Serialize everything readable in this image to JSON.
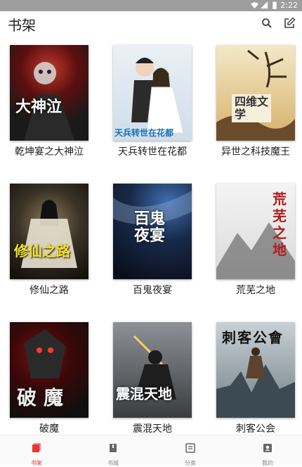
{
  "status_bar": {
    "time": "2:22"
  },
  "header": {
    "title": "书架"
  },
  "books": [
    {
      "title": "乾坤宴之大神泣",
      "cover_text": "大神泣"
    },
    {
      "title": "天兵转世在花都",
      "cover_text": "天兵转世在花都"
    },
    {
      "title": "异世之科技魔王",
      "cover_text": "四维文学"
    },
    {
      "title": "修仙之路",
      "cover_text": "修仙之路"
    },
    {
      "title": "百鬼夜宴",
      "cover_text": "百鬼夜宴"
    },
    {
      "title": "荒芜之地",
      "cover_text": "荒芜之地"
    },
    {
      "title": "破魔",
      "cover_text": "破魔"
    },
    {
      "title": "震混天地",
      "cover_text": "震混天地"
    },
    {
      "title": "刺客公会",
      "cover_text": "刺客公會"
    }
  ],
  "nav": [
    {
      "label": "书架",
      "icon": "bookshelf-icon",
      "active": true
    },
    {
      "label": "书城",
      "icon": "book-icon",
      "active": false
    },
    {
      "label": "分类",
      "icon": "category-icon",
      "active": false
    },
    {
      "label": "我的",
      "icon": "profile-icon",
      "active": false
    }
  ],
  "colors": {
    "accent": "#e53935",
    "statusbar": "#9e9e9e"
  }
}
